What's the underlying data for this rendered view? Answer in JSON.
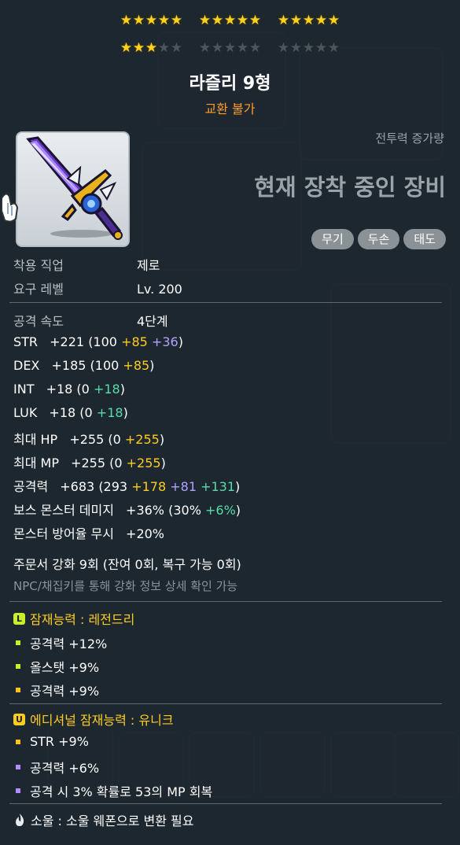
{
  "stars": {
    "total": 15,
    "filled": 18,
    "groups": 3,
    "per_group": 5,
    "rows": 2
  },
  "item": {
    "name": "라즐리 9형",
    "trade_status": "교환 불가",
    "combat_power_label": "전투력 증가량",
    "equip_status": "현재 장착 중인 장비",
    "tags": [
      "무기",
      "두손",
      "태도"
    ]
  },
  "requirements": {
    "job_label": "착용 직업",
    "job_value": "제로",
    "level_label": "요구 레벨",
    "level_value": "Lv. 200"
  },
  "stats": {
    "attack_speed": {
      "label": "공격 속도",
      "value": "4단계"
    },
    "str": {
      "label": "STR",
      "total": "+221",
      "open": "(100 ",
      "a": "+85",
      "b": " +36",
      "close": ")"
    },
    "dex": {
      "label": "DEX",
      "total": "+185",
      "open": "(100 ",
      "a": "+85",
      "close": ")"
    },
    "int": {
      "label": "INT",
      "total": "+18",
      "open": "(0 ",
      "a": "+18",
      "close": ")"
    },
    "luk": {
      "label": "LUK",
      "total": "+18",
      "open": "(0 ",
      "a": "+18",
      "close": ")"
    },
    "hp": {
      "label": "최대 HP",
      "total": "+255",
      "open": "(0 ",
      "a": "+255",
      "close": ")"
    },
    "mp": {
      "label": "최대 MP",
      "total": "+255",
      "open": "(0 ",
      "a": "+255",
      "close": ")"
    },
    "atk": {
      "label": "공격력",
      "total": "+683",
      "open": "(293 ",
      "a": "+178",
      "b": " +81",
      "c": " +131",
      "close": ")"
    },
    "boss": {
      "label": "보스 몬스터 데미지",
      "total": "+36%",
      "open": "(30% ",
      "a": "+6%",
      "close": ")"
    },
    "ied": {
      "label": "몬스터 방어율 무시",
      "total": "+20%"
    }
  },
  "enhance": {
    "scroll_text": "주문서 강화 9회 (잔여 0회, 복구 가능 0회)",
    "npc_note": "NPC/채집키를 통해 강화 정보 상세 확인 가능"
  },
  "potential": {
    "title": "잠재능력 : 레전드리",
    "badge": "L",
    "lines": [
      "공격력 +12%",
      "올스탯 +9%",
      "공격력 +9%"
    ]
  },
  "additional": {
    "title": "에디셔널 잠재능력 : 유니크",
    "badge": "U",
    "lines": [
      "STR +9%",
      "공격력 +6%",
      "공격 시 3% 확률로 53의 MP 회복"
    ]
  },
  "soul": {
    "text": "소울 : 소울 웨폰으로 변환 필요"
  },
  "colors": {
    "bg": "#1c262e",
    "orange": "#ff9c2a",
    "gold": "#ffcc22",
    "purple": "#b4a0ff",
    "cyan": "#55ddaa",
    "legend": "#c8ef2a"
  }
}
